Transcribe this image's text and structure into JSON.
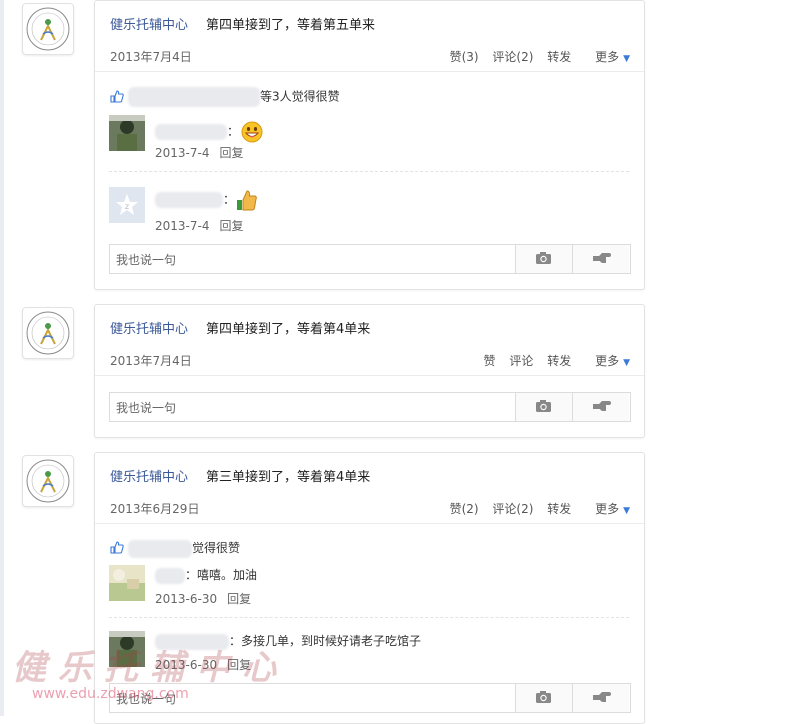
{
  "posts": [
    {
      "author": "健乐托辅中心",
      "text": "第四单接到了，等着第五单来",
      "date": "2013年7月4日",
      "actions": {
        "like": "赞(3)",
        "comment": "评论(2)",
        "share": "转发",
        "more": "更多"
      },
      "likes_text": "等3人觉得很赞",
      "comments": [
        {
          "text": "：",
          "date": "2013-7-4",
          "reply": "回复",
          "emoji": "grin"
        },
        {
          "text": "：",
          "date": "2013-7-4",
          "reply": "回复",
          "emoji": "thumbs-up"
        }
      ],
      "input_placeholder": "我也说一句"
    },
    {
      "author": "健乐托辅中心",
      "text": "第四单接到了，等着第4单来",
      "date": "2013年7月4日",
      "actions": {
        "like": "赞",
        "comment": "评论",
        "share": "转发",
        "more": "更多"
      },
      "input_placeholder": "我也说一句"
    },
    {
      "author": "健乐托辅中心",
      "text": "第三单接到了，等着第4单来",
      "date": "2013年6月29日",
      "actions": {
        "like": "赞(2)",
        "comment": "评论(2)",
        "share": "转发",
        "more": "更多"
      },
      "likes_text": "觉得很赞",
      "comments": [
        {
          "text": "：嘻嘻。加油",
          "date": "2013-6-30",
          "reply": "回复"
        },
        {
          "text": "：多接几单，到时候好请老子吃馆子",
          "date": "2013-6-30",
          "reply": "回复"
        }
      ],
      "input_placeholder": "我也说一句"
    }
  ],
  "watermark": {
    "title": "健乐托辅中心",
    "url": "www.edu.zdwang.com"
  },
  "colors": {
    "link": "#3b5998",
    "accent": "#3b7ad9"
  }
}
